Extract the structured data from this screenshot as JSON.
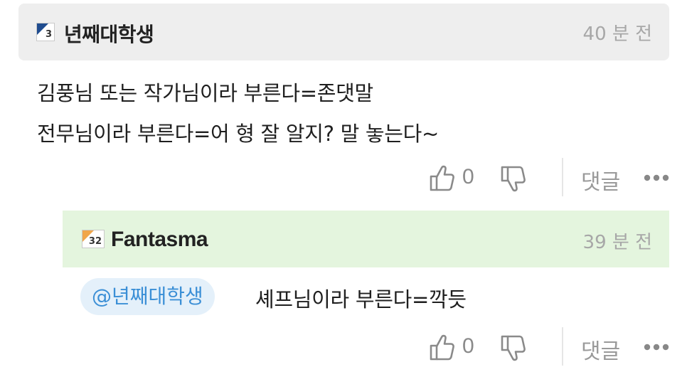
{
  "comments": [
    {
      "level": "3",
      "nickname": "년째대학생",
      "time": "40 분 전",
      "lines": [
        "김풍님 또는 작가님이라 부른다=존댓말",
        "전무님이라 부른다=어 형 잘 알지? 말 놓는다~"
      ],
      "like_count": "0",
      "reply_label": "댓글"
    },
    {
      "level": "32",
      "nickname": "Fantasma",
      "time": "39 분 전",
      "mention": "@년째대학생",
      "text": "셰프님이라 부른다=깍듯",
      "like_count": "0",
      "reply_label": "댓글"
    }
  ],
  "icons": {
    "like": "thumbs-up-icon",
    "dislike": "thumbs-down-icon",
    "more": "more-dots-icon"
  },
  "colors": {
    "main_header_bg": "#eeeeee",
    "reply_header_bg": "#e4f5de",
    "mention_bg": "#e4f0fa",
    "mention_text": "#3b8fd6",
    "meta_gray": "#a7a7a7"
  }
}
